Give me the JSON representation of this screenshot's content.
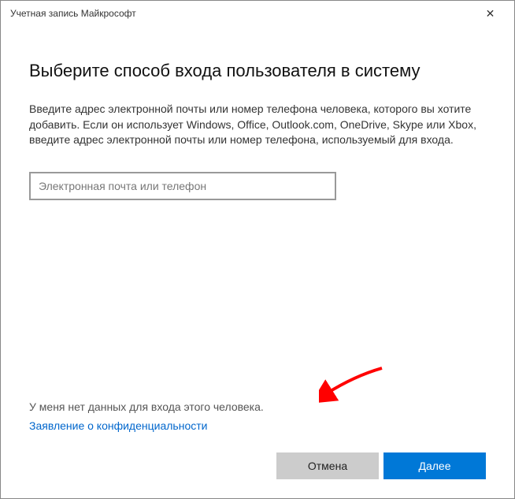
{
  "window": {
    "title": "Учетная запись Майкрософт"
  },
  "content": {
    "heading": "Выберите способ входа пользователя в систему",
    "description": "Введите адрес электронной почты или номер телефона человека, которого вы хотите добавить. Если он использует Windows, Office, Outlook.com, OneDrive, Skype или Xbox, введите адрес электронной почты или номер телефона, используемый для входа.",
    "input_placeholder": "Электронная почта или телефон",
    "input_value": "",
    "no_signin_info": "У меня нет данных для входа этого человека.",
    "privacy_link": "Заявление о конфиденциальности"
  },
  "buttons": {
    "cancel": "Отмена",
    "next": "Далее"
  },
  "annotation": {
    "arrow_color": "#ff0000"
  }
}
